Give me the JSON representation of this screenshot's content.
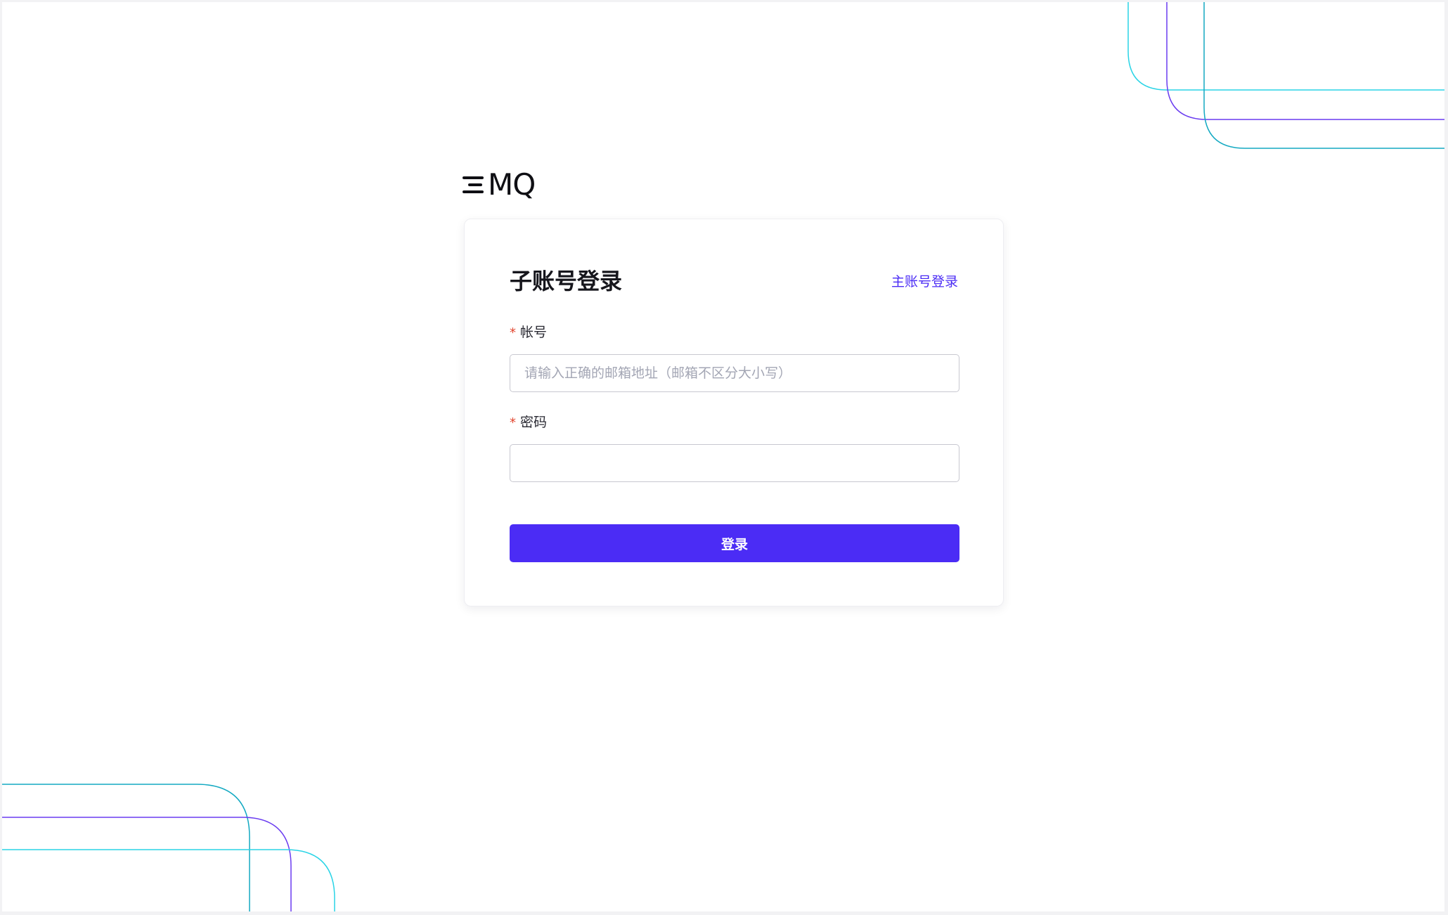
{
  "brand": {
    "logo_text": "MQ",
    "logo_mark": "E",
    "logo_full": "EMQ"
  },
  "login": {
    "title": "子账号登录",
    "switch_link": "主账号登录",
    "account": {
      "required_mark": "*",
      "label": "帐号",
      "placeholder": "请输入正确的邮箱地址（邮箱不区分大小写）",
      "value": ""
    },
    "password": {
      "required_mark": "*",
      "label": "密码",
      "placeholder": "",
      "value": ""
    },
    "submit_label": "登录"
  },
  "colors": {
    "accent": "#4b2cf5",
    "required": "#e2462f",
    "deco_cyan": "#2ad4e6",
    "deco_purple": "#6a3cf0",
    "deco_teal": "#13a9c2"
  }
}
